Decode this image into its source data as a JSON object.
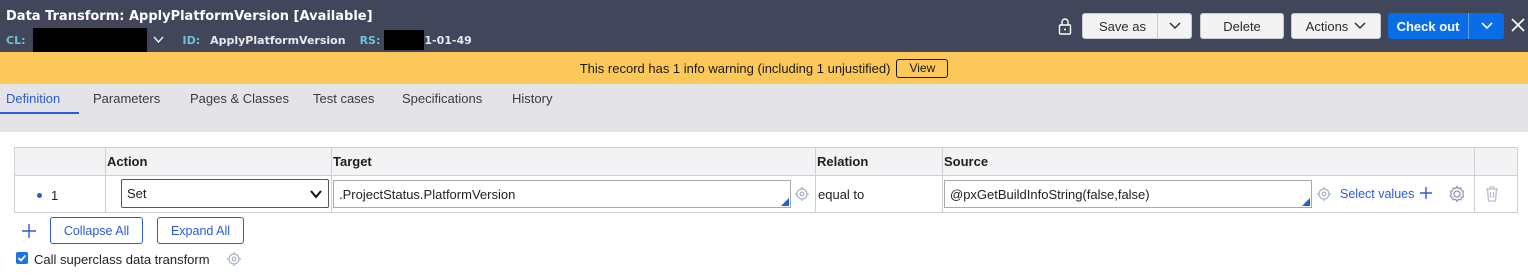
{
  "header": {
    "title": "Data Transform: ApplyPlatformVersion [Available]",
    "cl_label": "CL:",
    "id_label": "ID:",
    "id_value": "ApplyPlatformVersion",
    "rs_label": "RS:",
    "rs_value_suffix": "1-01-49",
    "save_as_label": "Save as",
    "delete_label": "Delete",
    "actions_label": "Actions",
    "check_out_label": "Check out"
  },
  "banner": {
    "message": "This record has 1 info warning (including 1 unjustified)",
    "view_label": "View",
    "color": "#fcc85a"
  },
  "tabs": [
    {
      "label": "Definition",
      "active": true
    },
    {
      "label": "Parameters"
    },
    {
      "label": "Pages & Classes"
    },
    {
      "label": "Test cases"
    },
    {
      "label": "Specifications"
    },
    {
      "label": "History"
    }
  ],
  "table": {
    "columns": [
      "Action",
      "Target",
      "Relation",
      "Source"
    ],
    "rows": [
      {
        "number": "1",
        "action": "Set",
        "target": ".ProjectStatus.PlatformVersion",
        "relation": "equal to",
        "source": "@pxGetBuildInfoString(false,false)",
        "select_values_label": "Select values"
      }
    ]
  },
  "controls": {
    "collapse_all_label": "Collapse All",
    "expand_all_label": "Expand All",
    "call_superclass_label": "Call superclass data transform",
    "call_superclass_checked": true
  },
  "colors": {
    "header_bg": "#41465a",
    "accent": "#2b5bd7",
    "primary_button": "#0a6de8"
  }
}
